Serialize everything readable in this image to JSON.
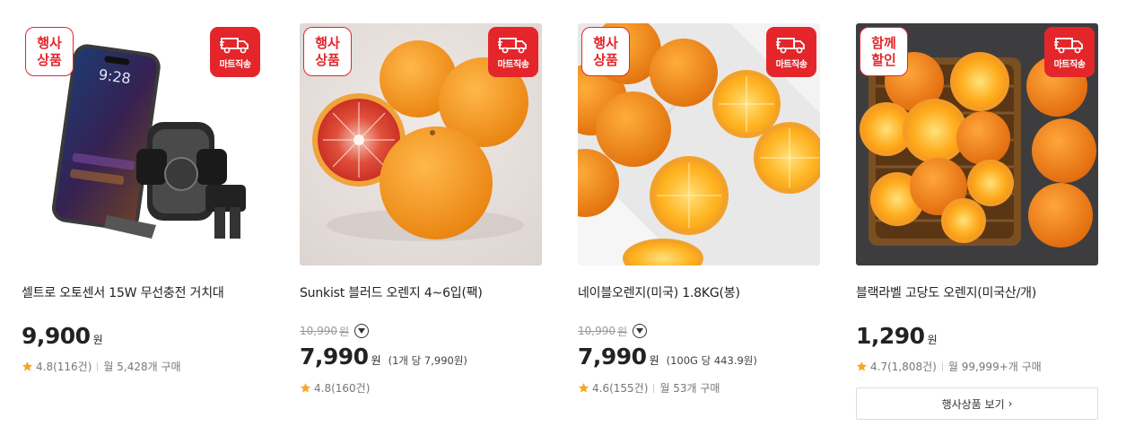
{
  "products": [
    {
      "promo_badge": [
        "행사",
        "상품"
      ],
      "delivery_badge": "마트직송",
      "name": "셀트로 오토센서 15W 무선충전 거치대",
      "price": "9,900",
      "currency": "원",
      "rating": "4.8",
      "reviews": "(116건)",
      "sales": "월 5,428개 구매"
    },
    {
      "promo_badge": [
        "행사",
        "상품"
      ],
      "delivery_badge": "마트직송",
      "name": "Sunkist 블러드 오렌지 4~6입(팩)",
      "original_price": "10,990",
      "original_currency": "원",
      "price": "7,990",
      "currency": "원",
      "unit_price": "(1개 당 7,990원)",
      "rating": "4.8",
      "reviews": "(160건)"
    },
    {
      "promo_badge": [
        "행사",
        "상품"
      ],
      "delivery_badge": "마트직송",
      "name": "네이블오렌지(미국) 1.8KG(봉)",
      "original_price": "10,990",
      "original_currency": "원",
      "price": "7,990",
      "currency": "원",
      "unit_price": "(100G 당 443.9원)",
      "rating": "4.6",
      "reviews": "(155건)",
      "sales": "월 53개 구매"
    },
    {
      "promo_badge": [
        "함께",
        "할인"
      ],
      "delivery_badge": "마트직송",
      "name": "블랙라벨 고당도 오렌지(미국산/개)",
      "price": "1,290",
      "currency": "원",
      "rating": "4.7",
      "reviews": "(1,808건)",
      "sales": "월 99,999+개 구매",
      "more_button": "행사상품 보기",
      "more_chevron": "›"
    }
  ],
  "colors": {
    "badge_red": "#e4262b",
    "star": "#f5a623",
    "orange": "#f5961d",
    "text_dark": "#222222",
    "text_gray": "#777777"
  },
  "icons": [
    "truck-icon",
    "star-icon",
    "chevron-down-icon",
    "chevron-right-icon"
  ]
}
